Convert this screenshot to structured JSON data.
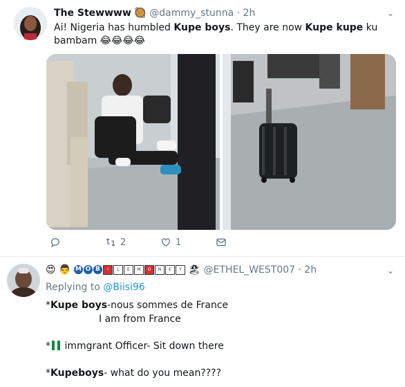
{
  "tweet1": {
    "display_name": "The Stewwww",
    "name_emoji": "🥘",
    "handle": "@dammy_stunna",
    "time": "2h",
    "text_parts": [
      {
        "text": "Ai! Nigeria has humbled ",
        "bold": false
      },
      {
        "text": "Kupe boys",
        "bold": true
      },
      {
        "text": ". They are now ",
        "bold": false
      },
      {
        "text": "Kupe kupe",
        "bold": true
      },
      {
        "text": " ku bambam ",
        "bold": false
      }
    ],
    "emojis": "😂😂😂😂",
    "actions": {
      "reply_count": "",
      "retweet_count": "2",
      "like_count": "1"
    }
  },
  "tweet2": {
    "name_emojis": [
      "😍",
      "👨",
      "🏖"
    ],
    "name_letters": [
      "M",
      "O",
      "B",
      "I",
      "L",
      "E",
      "M",
      "O",
      "N",
      "E",
      "Y"
    ],
    "handle": "@ETHEL_WEST007",
    "time": "2h",
    "replying_to_label": "Replying to",
    "replying_to_handle": "@Biisi96",
    "lines": [
      {
        "prefix": "*",
        "bold": "Kupe boys",
        "rest": "-nous sommes de France"
      },
      {
        "prefix": "",
        "bold": "",
        "rest": "I am from France"
      },
      {
        "prefix": "*",
        "bold": "",
        "rest": " immgrant Officer- Sit down there",
        "flag": true
      },
      {
        "prefix": "*",
        "bold": "Kupeboys",
        "rest": "- what do you mean????"
      }
    ]
  },
  "colors": {
    "text": "#14171a",
    "muted": "#657786",
    "link": "#1b95e0",
    "divider": "#e6ecf0"
  }
}
